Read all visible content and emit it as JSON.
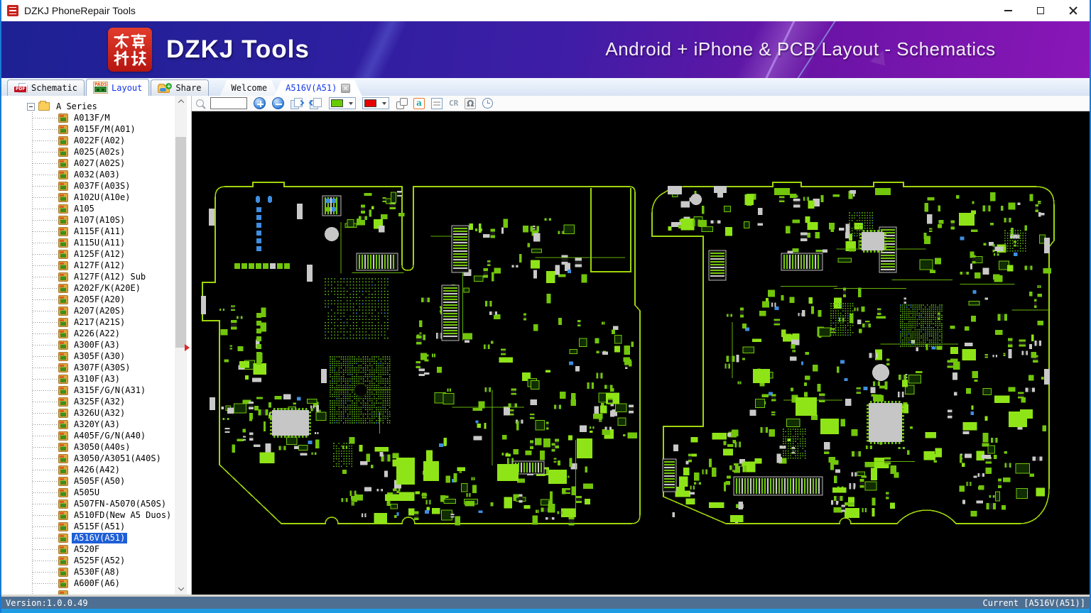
{
  "titlebar": {
    "title": "DZKJ PhoneRepair Tools"
  },
  "banner": {
    "logo_text": "东震科技",
    "brand": "DZKJ Tools",
    "tagline": "Android + iPhone & PCB Layout - Schematics"
  },
  "tabs": {
    "main": [
      {
        "label": "Schematic",
        "icon": "pdf-icon",
        "active": false,
        "badge": "PDF"
      },
      {
        "label": "Layout",
        "icon": "pads-icon",
        "active": true,
        "badge": "PADS"
      },
      {
        "label": "Share",
        "icon": "share-folder-icon",
        "active": false
      }
    ],
    "documents": [
      {
        "label": "Welcome",
        "active": false,
        "closable": false
      },
      {
        "label": "A516V(A51)",
        "active": true,
        "closable": true
      }
    ]
  },
  "toolbar": {
    "search_value": "",
    "a_label": "a",
    "cr_label": "CR",
    "omega_label": "Ω"
  },
  "tree": {
    "root_label": "A Series",
    "selected_label": "A516V(A51)",
    "items": [
      "A013F/M",
      "A015F/M(A01)",
      "A022F(A02)",
      "A025(A02s)",
      "A027(A02S)",
      "A032(A03)",
      "A037F(A03S)",
      "A102U(A10e)",
      "A105",
      "A107(A10S)",
      "A115F(A11)",
      "A115U(A11)",
      "A125F(A12)",
      "A127F(A12)",
      "A127F(A12) Sub",
      "A202F/K(A20E)",
      "A205F(A20)",
      "A207(A20S)",
      "A217(A21S)",
      "A226(A22)",
      "A300F(A3)",
      "A305F(A30)",
      "A307F(A30S)",
      "A310F(A3)",
      "A315F/G/N(A31)",
      "A325F(A32)",
      "A326U(A32)",
      "A320Y(A3)",
      "A405F/G/N(A40)",
      "A3050(A40s)",
      "A3050/A3051(A40S)",
      "A426(A42)",
      "A505F(A50)",
      "A505U",
      "A507FN-A5070(A50S)",
      "A510FD(New A5 Duos)",
      "A515F(A51)",
      "A516V(A51)",
      "A520F",
      "A525F(A52)",
      "A530F(A8)",
      "A600F(A6)",
      ""
    ]
  },
  "statusbar": {
    "left": "Version:1.0.0.49",
    "right": "Current [A516V(A51)]"
  },
  "pcb": {
    "colors": {
      "background": "#000000",
      "outline": "#9fd50c",
      "green": "#72c60b",
      "bright": "#8fe418",
      "gray": "#c9c9c9",
      "blue": "#3f8ee0",
      "dot": "#5fb50c"
    }
  }
}
